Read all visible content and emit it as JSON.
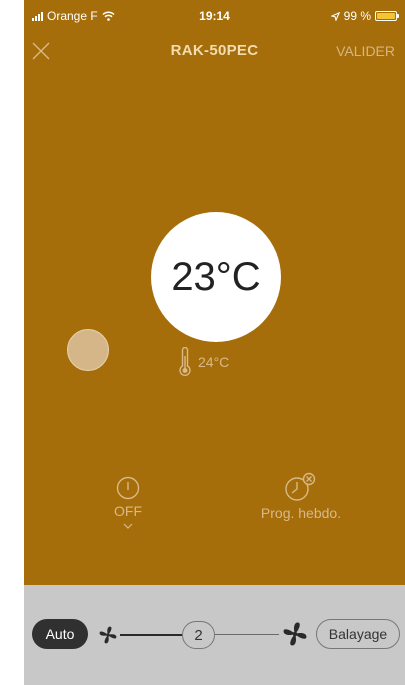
{
  "status_bar": {
    "carrier": "Orange F",
    "time": "19:14",
    "battery_text": "99 %",
    "battery_level": 0.99
  },
  "nav": {
    "title": "RAK-50PEC",
    "validate_label": "VALIDER",
    "close_icon": "close-icon"
  },
  "thermostat": {
    "setpoint": "23°C",
    "room_temp": "24°C"
  },
  "controls": {
    "power_label": "OFF",
    "schedule_label": "Prog. hebdo."
  },
  "bottom_bar": {
    "mode_label": "Auto",
    "fan_speed": "2",
    "swing_label": "Balayage"
  },
  "colors": {
    "main_background": "#a56e0b",
    "bottom_background": "#c8c8c8",
    "knob": "#d4b688"
  }
}
